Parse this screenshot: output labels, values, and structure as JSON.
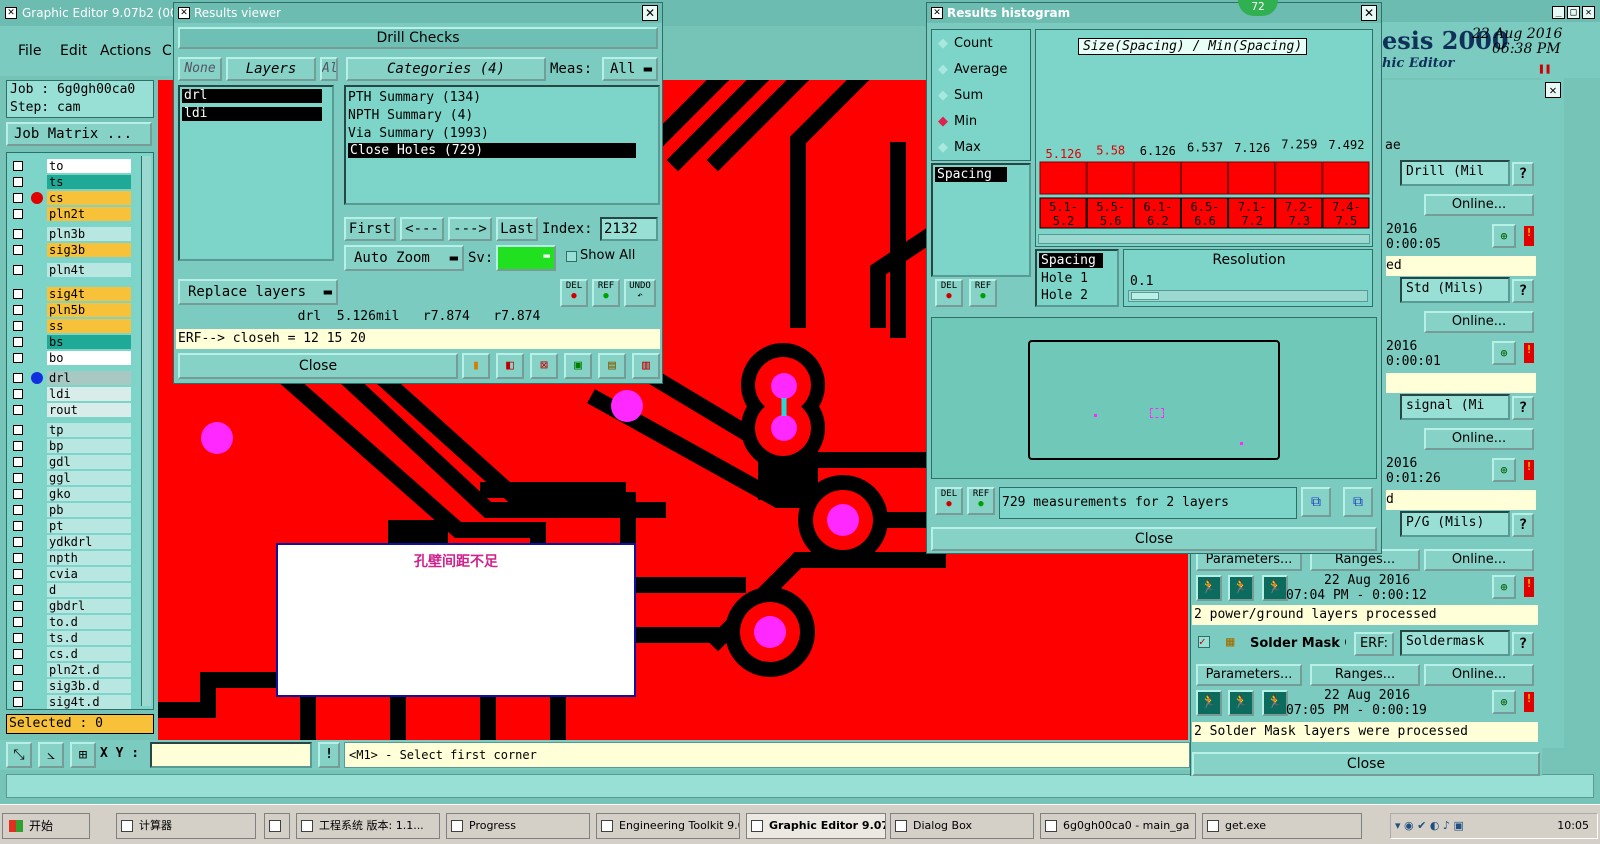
{
  "main_window": {
    "title": "Graphic Editor 9.07b2 (00",
    "menus": [
      "File",
      "Edit",
      "Actions",
      "C"
    ],
    "job": "Job : 6g0gh00ca0",
    "step": "Step: cam",
    "job_matrix": "Job Matrix ...",
    "brand": "esis 2000",
    "brand_sub": "hic Editor",
    "date": "22 Aug 2016",
    "time": "06:38 PM",
    "selected": "Selected : 0",
    "xy_label": "X Y :",
    "status_hint": "<M1> - Select first corner"
  },
  "layers": [
    {
      "name": "to",
      "color": "#ffffff"
    },
    {
      "name": "ts",
      "color": "#1faa98"
    },
    {
      "name": "cs",
      "color": "#f7c23a"
    },
    {
      "name": "pln2t",
      "color": "#f7c23a"
    },
    {
      "name": "pln3b",
      "color": "#b8e6e0"
    },
    {
      "name": "sig3b",
      "color": "#f7c23a"
    },
    {
      "name": "pln4t",
      "color": "#b8e6e0"
    },
    {
      "name": "sig4t",
      "color": "#f7c23a"
    },
    {
      "name": "pln5b",
      "color": "#f7c23a"
    },
    {
      "name": "ss",
      "color": "#f7c23a"
    },
    {
      "name": "bs",
      "color": "#1faa98"
    },
    {
      "name": "bo",
      "color": "#ffffff"
    },
    {
      "name": "drl",
      "color": "#a8c8c4"
    },
    {
      "name": "ldi",
      "color": "#d8ecea"
    },
    {
      "name": "rout",
      "color": "#d8ecea"
    },
    {
      "name": "tp",
      "color": "#b8e6e0"
    },
    {
      "name": "bp",
      "color": "#b8e6e0"
    },
    {
      "name": "gdl",
      "color": "#b8e6e0"
    },
    {
      "name": "ggl",
      "color": "#b8e6e0"
    },
    {
      "name": "gko",
      "color": "#b8e6e0"
    },
    {
      "name": "pb",
      "color": "#b8e6e0"
    },
    {
      "name": "pt",
      "color": "#b8e6e0"
    },
    {
      "name": "ydkdrl",
      "color": "#b8e6e0"
    },
    {
      "name": "npth",
      "color": "#b8e6e0"
    },
    {
      "name": "cvia",
      "color": "#b8e6e0"
    },
    {
      "name": "d",
      "color": "#b8e6e0"
    },
    {
      "name": "gbdrl",
      "color": "#b8e6e0"
    },
    {
      "name": "to.d",
      "color": "#b8e6e0"
    },
    {
      "name": "ts.d",
      "color": "#b8e6e0"
    },
    {
      "name": "cs.d",
      "color": "#b8e6e0"
    },
    {
      "name": "pln2t.d",
      "color": "#b8e6e0"
    },
    {
      "name": "sig3b.d",
      "color": "#b8e6e0"
    },
    {
      "name": "sig4t.d",
      "color": "#b8e6e0"
    }
  ],
  "results_viewer": {
    "title": "Results viewer",
    "header": "Drill Checks",
    "none": "None",
    "layers": "Layers",
    "all": "All",
    "categories": "Categories (4)",
    "meas_label": "Meas:",
    "meas_value": "All",
    "layer_list": [
      "drl",
      "ldi"
    ],
    "category_list": [
      "PTH Summary (134)",
      "NPTH Summary (4)",
      "Via Summary (1993)",
      "Close Holes (729)"
    ],
    "first": "First",
    "prev": "<---",
    "next": "--->",
    "last": "Last",
    "index_label": "Index:",
    "index_value": "2132",
    "auto_zoom": "Auto Zoom",
    "sv": "Sv:",
    "show_all": "Show All",
    "replace_layers": "Replace layers",
    "info": "drl  5.126mil   r7.874   r7.874",
    "erf": "ERF--> closeh = 12 15 20",
    "close": "Close",
    "del": "DEL",
    "ref": "REF",
    "undo": "UNDO"
  },
  "histogram": {
    "title": "Results histogram",
    "modes": [
      "Count",
      "Average",
      "Sum",
      "Min",
      "Max"
    ],
    "selected_mode": "Min",
    "series_list": [
      "Spacing"
    ],
    "chart_title": "Size(Spacing) / Min(Spacing)",
    "bins": [
      "5.1-5.2",
      "5.5-5.6",
      "6.1-6.2",
      "6.5-6.6",
      "7.1-7.2",
      "7.2-7.3",
      "7.4-7.5"
    ],
    "bin_values": [
      "5.126",
      "5.58",
      "6.126",
      "6.537",
      "7.126",
      "7.259",
      "7.492"
    ],
    "fields": [
      "Spacing",
      "Hole 1",
      "Hole 2"
    ],
    "resolution_label": "Resolution",
    "resolution_value": "0.1",
    "measurements": "729 measurements for 2 layers",
    "close": "Close",
    "badge": "72"
  },
  "checklist": {
    "rows": [
      {
        "value": "Drill (Mil",
        "online": "Online...",
        "date": "2016",
        "time": "0:00:05",
        "status": "ed"
      },
      {
        "value": "Std (Mils)",
        "online": "Online...",
        "date": "2016",
        "time": "0:00:01",
        "status": ""
      },
      {
        "value": "signal (Mi",
        "online": "Online...",
        "date": "2016",
        "time": "0:01:26",
        "status": "d"
      },
      {
        "value": "P/G (Mils)",
        "online": "Online..."
      }
    ],
    "parameters": "Parameters...",
    "ranges": "Ranges...",
    "pg_date": "22 Aug 2016",
    "pg_time": "07:04 PM - 0:00:12",
    "pg_status": "2 power/ground layers processed",
    "sm_name": "Solder Mask Ch",
    "sm_erf": "ERF:",
    "sm_value": "Soldermask",
    "sm_online": "Online...",
    "sm_date": "22 Aug 2016",
    "sm_time": "07:05 PM - 0:00:19",
    "sm_status": "2 Solder Mask layers were processed",
    "close": "Close",
    "ae": "ae"
  },
  "canvas": {
    "note": "孔壁间距不足"
  },
  "taskbar": {
    "start": "开始",
    "items": [
      "计算器",
      "工程系统  版本: 1.1...",
      "Progress",
      "Engineering Toolkit 9.0...",
      "Graphic Editor 9.07b...",
      "Dialog Box",
      "6g0gh00ca0 - main_ga",
      "get.exe"
    ],
    "clock": "10:05"
  }
}
